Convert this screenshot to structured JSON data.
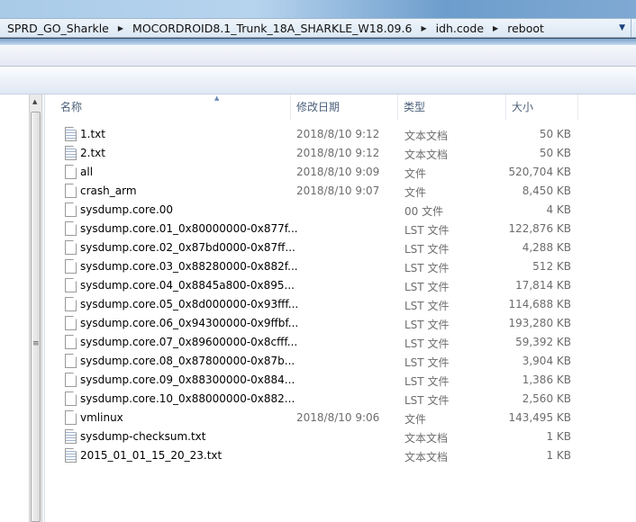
{
  "breadcrumb": [
    "SPRD_GO_Sharkle",
    "MOCORDROID8.1_Trunk_18A_SHARKLE_W18.09.6",
    "idh.code",
    "reboot"
  ],
  "columns": {
    "name": "名称",
    "date": "修改日期",
    "type": "类型",
    "size": "大小"
  },
  "files": [
    {
      "name": "1.txt",
      "date": "2018/8/10 9:12",
      "type": "文本文档",
      "size": "50 KB",
      "icon": "text-file"
    },
    {
      "name": "2.txt",
      "date": "2018/8/10 9:12",
      "type": "文本文档",
      "size": "50 KB",
      "icon": "text-file"
    },
    {
      "name": "all",
      "date": "2018/8/10 9:09",
      "type": "文件",
      "size": "520,704 KB",
      "icon": "file"
    },
    {
      "name": "crash_arm",
      "date": "2018/8/10 9:07",
      "type": "文件",
      "size": "8,450 KB",
      "icon": "file"
    },
    {
      "name": "sysdump.core.00",
      "date": "",
      "type": "00 文件",
      "size": "4 KB",
      "icon": "file"
    },
    {
      "name": "sysdump.core.01_0x80000000-0x877f...",
      "date": "",
      "type": "LST 文件",
      "size": "122,876 KB",
      "icon": "file"
    },
    {
      "name": "sysdump.core.02_0x87bd0000-0x87ff...",
      "date": "",
      "type": "LST 文件",
      "size": "4,288 KB",
      "icon": "file"
    },
    {
      "name": "sysdump.core.03_0x88280000-0x882f...",
      "date": "",
      "type": "LST 文件",
      "size": "512 KB",
      "icon": "file"
    },
    {
      "name": "sysdump.core.04_0x8845a800-0x895...",
      "date": "",
      "type": "LST 文件",
      "size": "17,814 KB",
      "icon": "file"
    },
    {
      "name": "sysdump.core.05_0x8d000000-0x93fff...",
      "date": "",
      "type": "LST 文件",
      "size": "114,688 KB",
      "icon": "file"
    },
    {
      "name": "sysdump.core.06_0x94300000-0x9ffbf...",
      "date": "",
      "type": "LST 文件",
      "size": "193,280 KB",
      "icon": "file"
    },
    {
      "name": "sysdump.core.07_0x89600000-0x8cfff...",
      "date": "",
      "type": "LST 文件",
      "size": "59,392 KB",
      "icon": "file"
    },
    {
      "name": "sysdump.core.08_0x87800000-0x87b...",
      "date": "",
      "type": "LST 文件",
      "size": "3,904 KB",
      "icon": "file"
    },
    {
      "name": "sysdump.core.09_0x88300000-0x884...",
      "date": "",
      "type": "LST 文件",
      "size": "1,386 KB",
      "icon": "file"
    },
    {
      "name": "sysdump.core.10_0x88000000-0x882...",
      "date": "",
      "type": "LST 文件",
      "size": "2,560 KB",
      "icon": "file"
    },
    {
      "name": "vmlinux",
      "date": "2018/8/10 9:06",
      "type": "文件",
      "size": "143,495 KB",
      "icon": "file"
    },
    {
      "name": "sysdump-checksum.txt",
      "date": "",
      "type": "文本文档",
      "size": "1 KB",
      "icon": "text-file"
    },
    {
      "name": "2015_01_01_15_20_23.txt",
      "date": "",
      "type": "文本文档",
      "size": "1 KB",
      "icon": "text-file"
    }
  ]
}
